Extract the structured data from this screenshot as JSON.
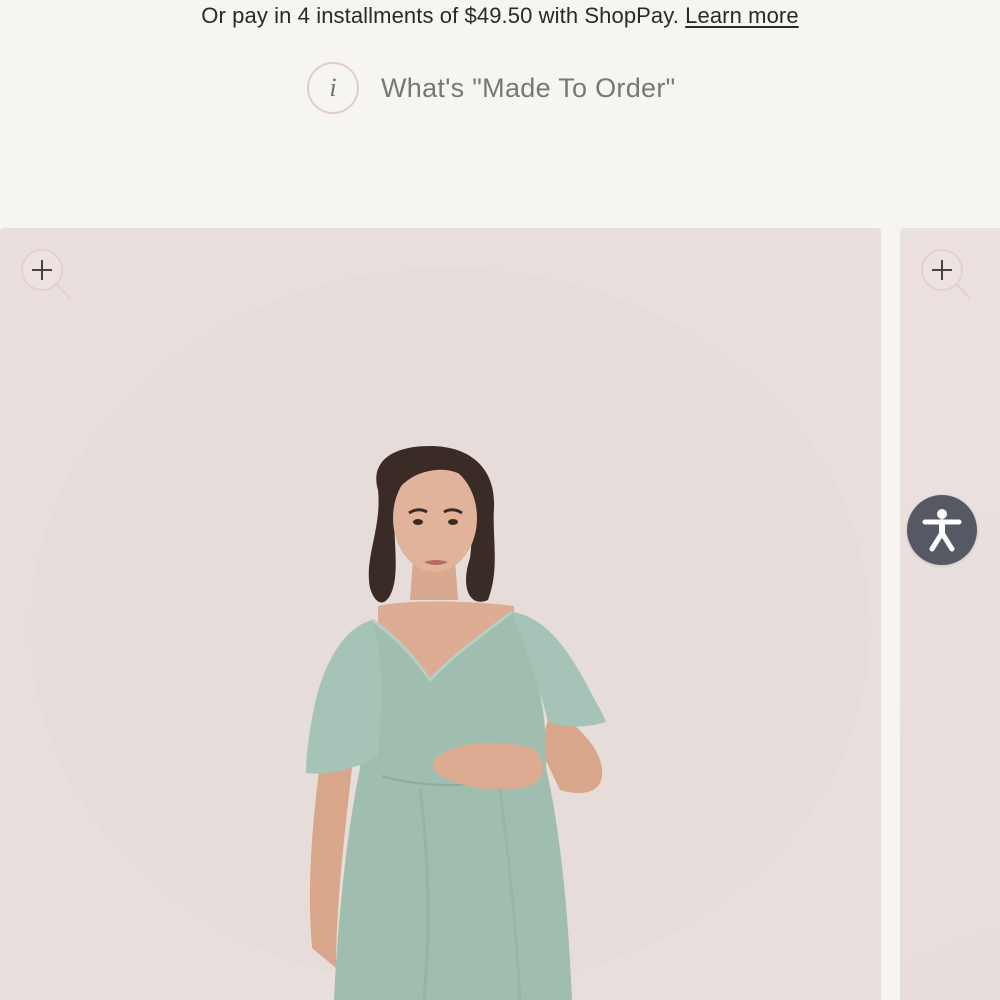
{
  "payment": {
    "installments_text": "Or pay in 4 installments of $49.50 with ShopPay.",
    "learn_more": "Learn more"
  },
  "made_to_order": {
    "icon_glyph": "i",
    "label": "What's \"Made To Order\""
  },
  "gallery": {
    "zoom_icon": "zoom-in-icon",
    "main_image": "model-in-sage-green-flutter-sleeve-dress",
    "next_image": "next-slide-partial"
  },
  "accessibility": {
    "icon": "accessibility-icon",
    "color": "#565963"
  },
  "colors": {
    "page_bg": "#f6f5f2",
    "photo_bg": "#e8dedc",
    "dress": "#9dbdaf"
  }
}
